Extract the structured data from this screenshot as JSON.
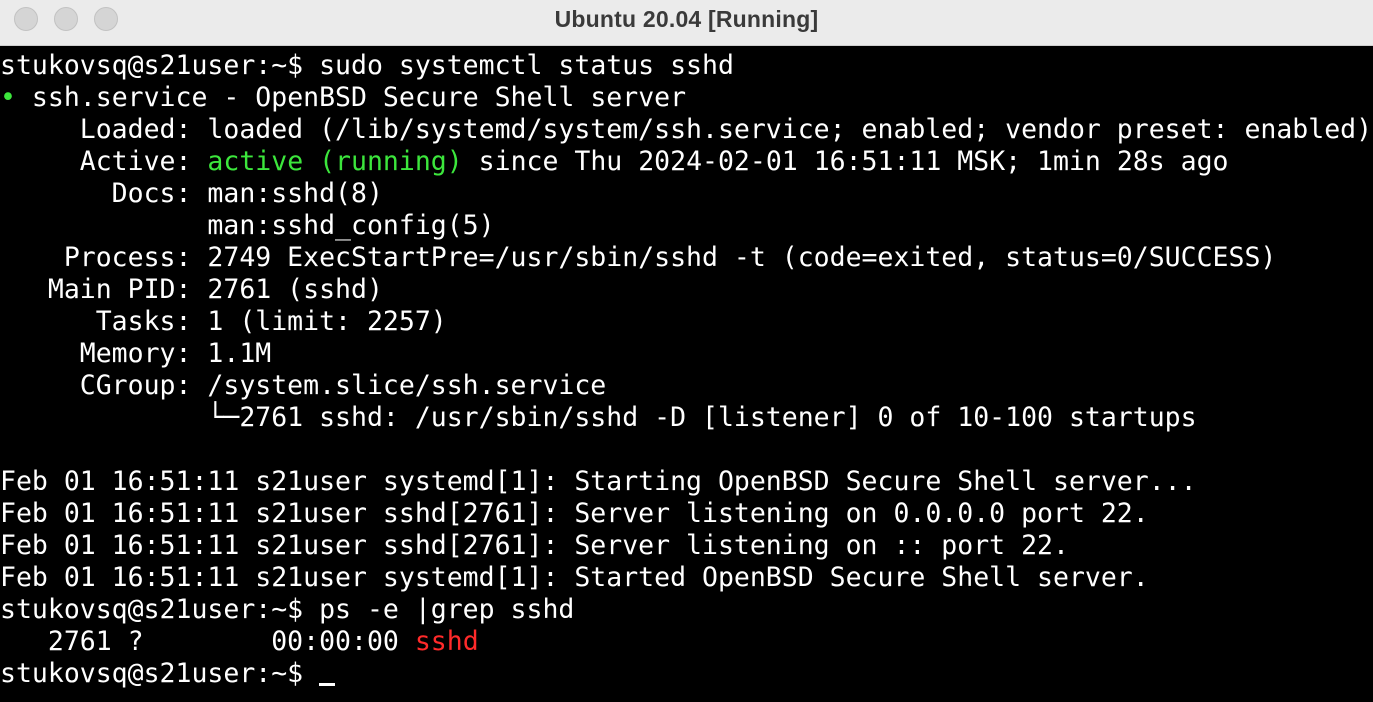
{
  "window": {
    "title": "Ubuntu 20.04 [Running]"
  },
  "terminal": {
    "prompt": "stukovsq@s21user:~$ ",
    "command1": "sudo systemctl status sshd",
    "status_dot": "•",
    "service_line": " ssh.service - OpenBSD Secure Shell server",
    "loaded_line": "     Loaded: loaded (/lib/systemd/system/ssh.service; enabled; vendor preset: enabled)",
    "active_label": "     Active: ",
    "active_state": "active (running)",
    "active_rest": " since Thu 2024-02-01 16:51:11 MSK; 1min 28s ago",
    "docs_line1": "       Docs: man:sshd(8)",
    "docs_line2": "             man:sshd_config(5)",
    "process_line": "    Process: 2749 ExecStartPre=/usr/sbin/sshd -t (code=exited, status=0/SUCCESS)",
    "mainpid_line": "   Main PID: 2761 (sshd)",
    "tasks_line": "      Tasks: 1 (limit: 2257)",
    "memory_line": "     Memory: 1.1M",
    "cgroup_line": "     CGroup: /system.slice/ssh.service",
    "cgroup_child_line": "             └─2761 sshd: /usr/sbin/sshd -D [listener] 0 of 10-100 startups",
    "logs": [
      "Feb 01 16:51:11 s21user systemd[1]: Starting OpenBSD Secure Shell server...",
      "Feb 01 16:51:11 s21user sshd[2761]: Server listening on 0.0.0.0 port 22.",
      "Feb 01 16:51:11 s21user sshd[2761]: Server listening on :: port 22.",
      "Feb 01 16:51:11 s21user systemd[1]: Started OpenBSD Secure Shell server."
    ],
    "command2": "ps -e |grep sshd",
    "ps_prefix": "   2761 ?        00:00:00 ",
    "ps_match": "sshd",
    "command3": ""
  },
  "colors": {
    "active_green": "#3ce63c",
    "match_red": "#ff2a2a",
    "background": "#000000",
    "titlebar": "#ebebeb"
  }
}
